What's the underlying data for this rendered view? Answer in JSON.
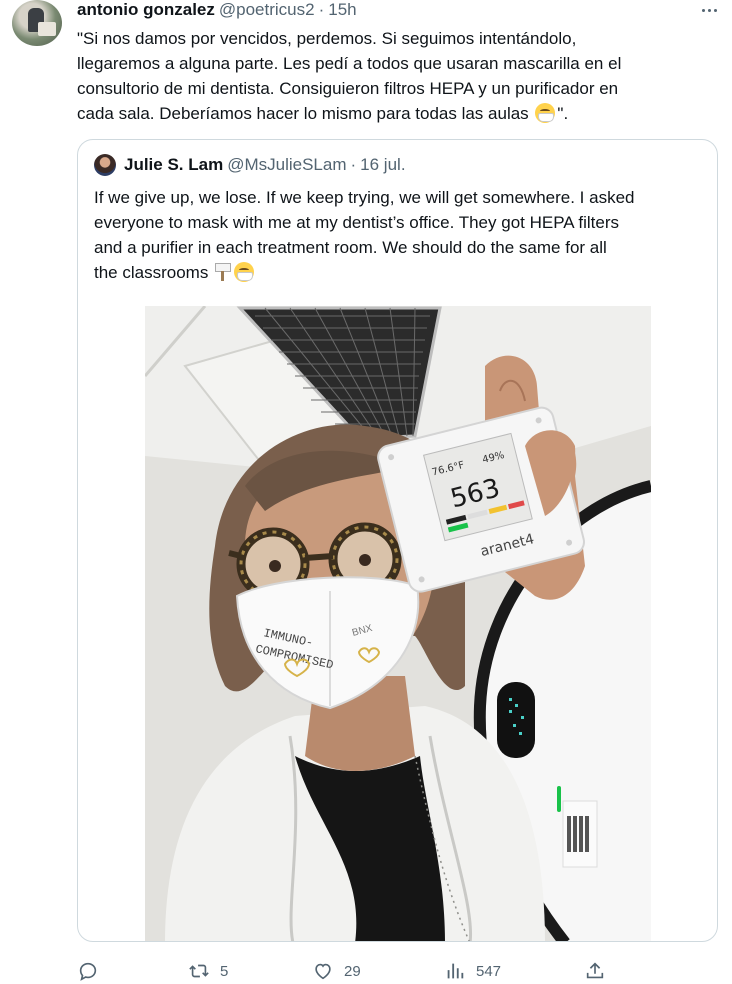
{
  "tweet": {
    "author_name": "antonio gonzalez",
    "author_handle": "@poetricus2",
    "separator": "·",
    "time": "15h",
    "text_lines": [
      "\"Si nos damos por vencidos, perdemos. Si seguimos intentándolo,",
      "llegaremos a alguna parte. Les pedí a todos que usaran mascarilla  en el",
      "consultorio de mi dentista. Consiguieron filtros HEPA y un purificador en",
      "cada sala. Deberíamos hacer lo mismo para todas las aulas"
    ],
    "text_end": "\".",
    "more_icon": "more-horizontal-icon"
  },
  "quote": {
    "author_name": "Julie S. Lam",
    "author_handle": "@MsJulieSLam",
    "separator": "·",
    "date": "16 jul.",
    "text_lines": [
      "If we give up, we lose. If we keep trying, we will get somewhere. I asked",
      "everyone to mask with me at my dentist’s office. They got HEPA filters",
      "and a purifier in each treatment room. We should do the same for all",
      "the classrooms"
    ],
    "photo": {
      "device_brand": "aranet4",
      "co2_reading": "563",
      "temperature": "76.6°F",
      "humidity": "49%",
      "mask_text_line1": "IMMUNO-",
      "mask_text_line2": "COMPROMISED",
      "mask_brand": "BNX"
    }
  },
  "actions": {
    "reply": {
      "icon": "reply-icon",
      "count": ""
    },
    "retweet": {
      "icon": "retweet-icon",
      "count": "5"
    },
    "like": {
      "icon": "heart-icon",
      "count": "29"
    },
    "views": {
      "icon": "views-icon",
      "count": "547"
    },
    "share": {
      "icon": "share-icon",
      "count": ""
    }
  },
  "colors": {
    "text": "#0f1419",
    "secondary": "#536471",
    "border": "#cfd9de",
    "co2_green": "#19c24a",
    "mask_emoji": "#ffd24c"
  }
}
